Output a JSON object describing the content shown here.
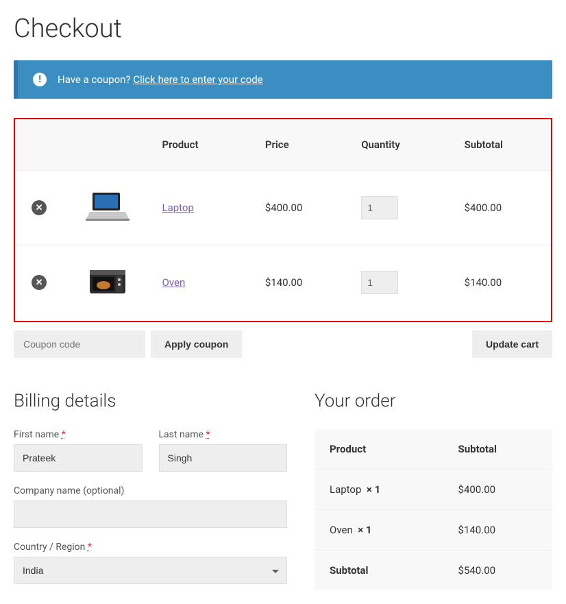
{
  "page_title": "Checkout",
  "coupon_banner": {
    "prefix": "Have a coupon?",
    "link": "Click here to enter your code"
  },
  "cart": {
    "headers": {
      "product": "Product",
      "price": "Price",
      "quantity": "Quantity",
      "subtotal": "Subtotal"
    },
    "items": [
      {
        "name": "Laptop",
        "price": "$400.00",
        "qty": "1",
        "subtotal": "$400.00",
        "thumb": "laptop"
      },
      {
        "name": "Oven",
        "price": "$140.00",
        "qty": "1",
        "subtotal": "$140.00",
        "thumb": "oven"
      }
    ],
    "coupon_placeholder": "Coupon code",
    "apply_label": "Apply coupon",
    "update_label": "Update cart"
  },
  "billing": {
    "title": "Billing details",
    "first_name_label": "First name",
    "first_name_value": "Prateek",
    "last_name_label": "Last name",
    "last_name_value": "Singh",
    "company_label": "Company name (optional)",
    "company_value": "",
    "country_label": "Country / Region",
    "country_value": "India",
    "required_marker": "*"
  },
  "order": {
    "title": "Your order",
    "header_product": "Product",
    "header_subtotal": "Subtotal",
    "lines": [
      {
        "name": "Laptop",
        "qty": "× 1",
        "subtotal": "$400.00"
      },
      {
        "name": "Oven",
        "qty": "× 1",
        "subtotal": "$140.00"
      }
    ],
    "subtotal_label": "Subtotal",
    "subtotal_value": "$540.00"
  }
}
